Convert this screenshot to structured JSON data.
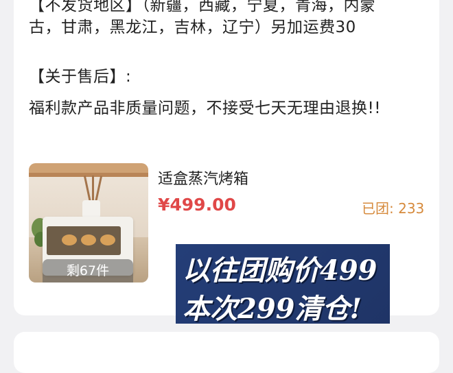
{
  "text": {
    "line1": "【不发货地区】（新疆，西藏，宁夏，青海，内蒙",
    "line2": "古，甘肃，黑龙江，吉林，辽宁）另加运费30",
    "line3": "【关于售后】:",
    "line4": "福利款产品非质量问题，不接受七天无理由退换!!"
  },
  "product": {
    "name": "适盒蒸汽烤箱",
    "price": "¥499.00",
    "sold": "已团: 233",
    "stock_label": "剩67件"
  },
  "banner": {
    "line1": "以往团购价499",
    "line2": "本次299清仓!"
  },
  "colors": {
    "price": "#e04848",
    "sold": "#d68a3c",
    "banner_bg": "#243e78"
  }
}
